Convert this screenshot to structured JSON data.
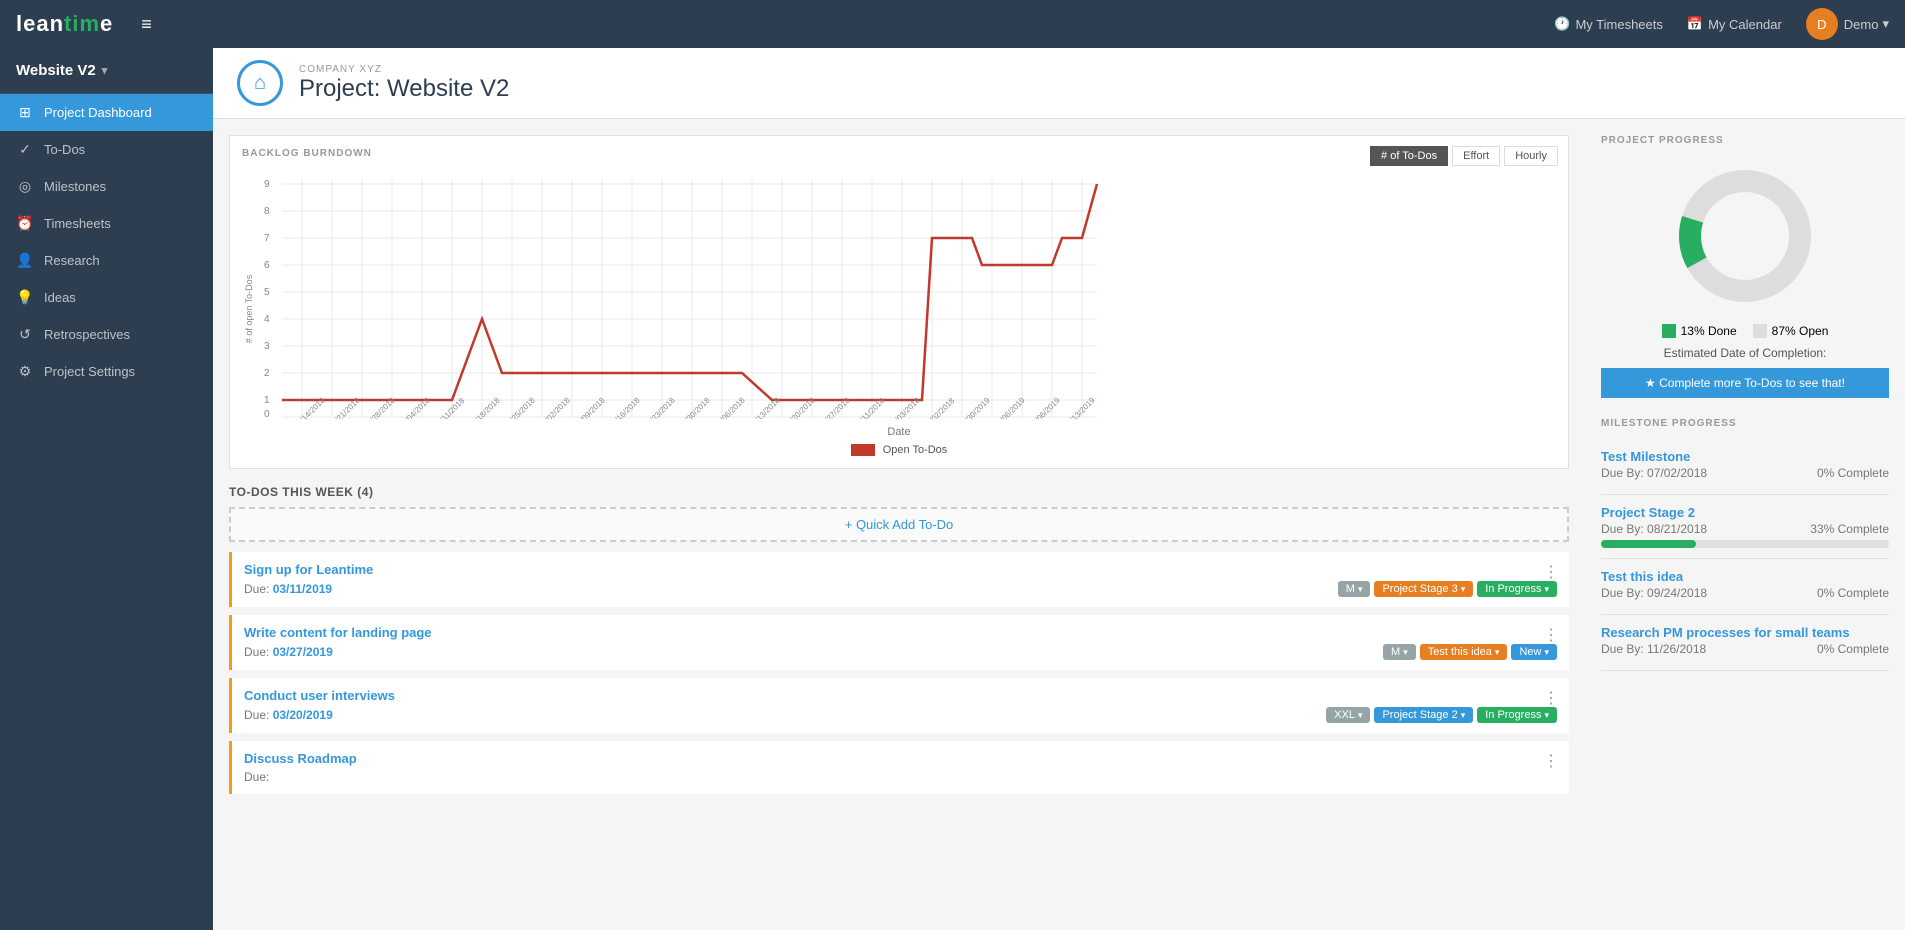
{
  "app": {
    "logo_text": "leantime",
    "top_nav": {
      "timesheets_label": "My Timesheets",
      "calendar_label": "My Calendar",
      "user_label": "Demo"
    }
  },
  "sidebar": {
    "project_name": "Website V2",
    "items": [
      {
        "id": "project-dashboard",
        "label": "Project Dashboard",
        "icon": "⊞",
        "active": true
      },
      {
        "id": "todos",
        "label": "To-Dos",
        "icon": "✓"
      },
      {
        "id": "milestones",
        "label": "Milestones",
        "icon": "◎"
      },
      {
        "id": "timesheets",
        "label": "Timesheets",
        "icon": "⏰"
      },
      {
        "id": "research",
        "label": "Research",
        "icon": "👤"
      },
      {
        "id": "ideas",
        "label": "Ideas",
        "icon": "💡"
      },
      {
        "id": "retrospectives",
        "label": "Retrospectives",
        "icon": "↺"
      },
      {
        "id": "project-settings",
        "label": "Project Settings",
        "icon": "⚙"
      }
    ]
  },
  "project": {
    "company": "COMPANY XYZ",
    "title": "Project: Website V2"
  },
  "chart": {
    "section_title": "BACKLOG BURNDOWN",
    "buttons": [
      "# of To-Dos",
      "Effort",
      "Hourly"
    ],
    "active_button": "# of To-Dos",
    "x_label": "Date",
    "legend_label": "Open To-Dos",
    "y_max": 9
  },
  "todos": {
    "section_title": "TO-DOS THIS WEEK (4)",
    "quick_add_label": "+ Quick Add To-Do",
    "items": [
      {
        "id": "todo-1",
        "title": "Sign up for Leantime",
        "due_label": "Due:",
        "due_date": "03/11/2019",
        "tags": [
          {
            "label": "M",
            "type": "grey",
            "has_caret": true
          },
          {
            "label": "Project Stage 3",
            "type": "orange",
            "has_caret": true
          },
          {
            "label": "In Progress",
            "type": "green",
            "has_caret": true
          }
        ]
      },
      {
        "id": "todo-2",
        "title": "Write content for landing page",
        "due_label": "Due:",
        "due_date": "03/27/2019",
        "tags": [
          {
            "label": "M",
            "type": "grey",
            "has_caret": true
          },
          {
            "label": "Test this idea",
            "type": "orange",
            "has_caret": true
          },
          {
            "label": "New",
            "type": "blue",
            "has_caret": true
          }
        ]
      },
      {
        "id": "todo-3",
        "title": "Conduct user interviews",
        "due_label": "Due:",
        "due_date": "03/20/2019",
        "tags": [
          {
            "label": "XXL",
            "type": "grey",
            "has_caret": true
          },
          {
            "label": "Project Stage 2",
            "type": "blue",
            "has_caret": true
          },
          {
            "label": "In Progress",
            "type": "green",
            "has_caret": true
          }
        ]
      },
      {
        "id": "todo-4",
        "title": "Discuss Roadmap",
        "due_label": "Due:",
        "due_date": "",
        "tags": []
      }
    ]
  },
  "right": {
    "progress_title": "PROJECT PROGRESS",
    "done_percent": 13,
    "open_percent": 87,
    "done_label": "13% Done",
    "open_label": "87% Open",
    "est_completion_label": "Estimated Date of Completion:",
    "complete_btn_label": "★ Complete more To-Dos to see that!",
    "milestone_title": "MILESTONE PROGRESS",
    "milestones": [
      {
        "name": "Test Milestone",
        "due": "Due By: 07/02/2018",
        "complete": "0% Complete",
        "fill_pct": 0
      },
      {
        "name": "Project Stage 2",
        "due": "Due By: 08/21/2018",
        "complete": "33% Complete",
        "fill_pct": 33
      },
      {
        "name": "Test this idea",
        "due": "Due By: 09/24/2018",
        "complete": "0% Complete",
        "fill_pct": 0
      },
      {
        "name": "Research PM processes for small teams",
        "due": "Due By: 11/26/2018",
        "complete": "0% Complete",
        "fill_pct": 0
      }
    ]
  }
}
